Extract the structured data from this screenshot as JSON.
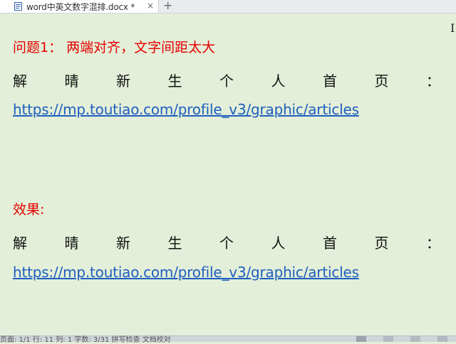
{
  "tab": {
    "title": "word中英文数字混排.docx *",
    "close_glyph": "×",
    "new_glyph": "+"
  },
  "document": {
    "heading1": "问题1： 两端对齐，文字间距太大",
    "justified_chars": [
      "解",
      "晴",
      "新",
      "生",
      "个",
      "人",
      "首",
      "页",
      "："
    ],
    "link": "https://mp.toutiao.com/profile_v3/graphic/articles",
    "heading2": "效果:"
  },
  "statusbar": {
    "text": "页面: 1/1  行: 11  列: 1  字数: 3/31  拼写检查  文档校对"
  },
  "colors": {
    "background": "#e3efd8",
    "heading": "#e60000",
    "link": "#1f5fbf"
  }
}
